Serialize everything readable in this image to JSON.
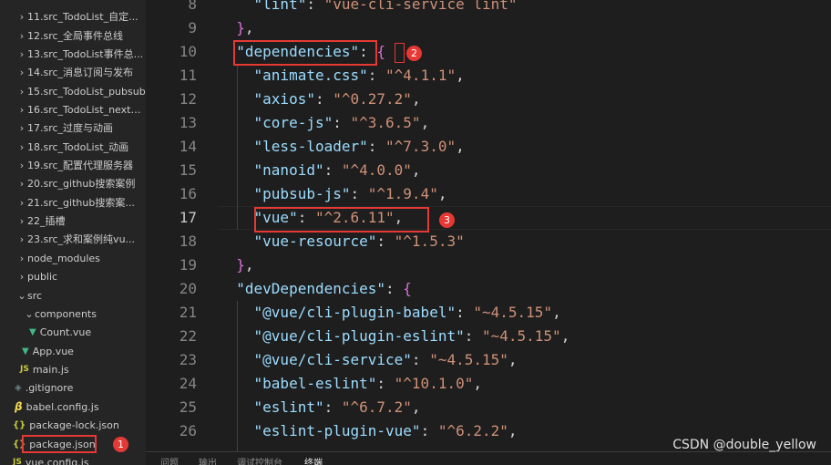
{
  "explorer": {
    "items": [
      {
        "label": "11.src_TodoList_自定...",
        "icon": "chevron-right",
        "kind": "folder"
      },
      {
        "label": "12.src_全局事件总线",
        "icon": "chevron-right",
        "kind": "folder"
      },
      {
        "label": "13.src_TodoList事件总...",
        "icon": "chevron-right",
        "kind": "folder"
      },
      {
        "label": "14.src_消息订阅与发布",
        "icon": "chevron-right",
        "kind": "folder"
      },
      {
        "label": "15.src_TodoList_pubsub",
        "icon": "chevron-right",
        "kind": "folder"
      },
      {
        "label": "16.src_TodoList_nextTi...",
        "icon": "chevron-right",
        "kind": "folder"
      },
      {
        "label": "17.src_过度与动画",
        "icon": "chevron-right",
        "kind": "folder"
      },
      {
        "label": "18.src_TodoList_动画",
        "icon": "chevron-right",
        "kind": "folder"
      },
      {
        "label": "19.src_配置代理服务器",
        "icon": "chevron-right",
        "kind": "folder"
      },
      {
        "label": "20.src_github搜索案例",
        "icon": "chevron-right",
        "kind": "folder"
      },
      {
        "label": "21.src_github搜索案...",
        "icon": "chevron-right",
        "kind": "folder"
      },
      {
        "label": "22_插槽",
        "icon": "chevron-right",
        "kind": "folder"
      },
      {
        "label": "23.src_求和案例纯vu...",
        "icon": "chevron-right",
        "kind": "folder"
      },
      {
        "label": "node_modules",
        "icon": "chevron-right",
        "kind": "folder"
      },
      {
        "label": "public",
        "icon": "chevron-right",
        "kind": "folder"
      },
      {
        "label": "src",
        "icon": "chevron-down",
        "kind": "folder"
      },
      {
        "label": "components",
        "icon": "chevron-down",
        "kind": "folder"
      },
      {
        "label": "Count.vue",
        "icon": "vue-file",
        "kind": "file"
      },
      {
        "label": "App.vue",
        "icon": "vue-file",
        "kind": "file"
      },
      {
        "label": "main.js",
        "icon": "js-file",
        "kind": "file"
      },
      {
        "label": ".gitignore",
        "icon": "git-file",
        "kind": "file"
      },
      {
        "label": "babel.config.js",
        "icon": "babel-file",
        "kind": "file"
      },
      {
        "label": "package-lock.json",
        "icon": "json-file",
        "kind": "file"
      },
      {
        "label": "package.json",
        "icon": "json-file",
        "kind": "file"
      },
      {
        "label": "vue.config.js",
        "icon": "js-file",
        "kind": "file"
      }
    ]
  },
  "icons": {
    "chevron_right": "›",
    "chevron_down": "⌄",
    "vue": "▼",
    "js": "JS",
    "git": "◈",
    "babel": "β",
    "json": "{}"
  },
  "editor": {
    "active_line": "17",
    "lines": [
      {
        "n": "8",
        "text": "    \"lint\": \"vue-cli-service lint\""
      },
      {
        "n": "9",
        "text": "  },"
      },
      {
        "n": "10",
        "text": "  \"dependencies\": {"
      },
      {
        "n": "11",
        "text": "    \"animate.css\": \"^4.1.1\","
      },
      {
        "n": "12",
        "text": "    \"axios\": \"^0.27.2\","
      },
      {
        "n": "13",
        "text": "    \"core-js\": \"^3.6.5\","
      },
      {
        "n": "14",
        "text": "    \"less-loader\": \"^7.3.0\","
      },
      {
        "n": "15",
        "text": "    \"nanoid\": \"^4.0.0\","
      },
      {
        "n": "16",
        "text": "    \"pubsub-js\": \"^1.9.4\","
      },
      {
        "n": "17",
        "text": "    \"vue\": \"^2.6.11\","
      },
      {
        "n": "18",
        "text": "    \"vue-resource\": \"^1.5.3\""
      },
      {
        "n": "19",
        "text": "  },"
      },
      {
        "n": "20",
        "text": "  \"devDependencies\": {"
      },
      {
        "n": "21",
        "text": "    \"@vue/cli-plugin-babel\": \"~4.5.15\","
      },
      {
        "n": "22",
        "text": "    \"@vue/cli-plugin-eslint\": \"~4.5.15\","
      },
      {
        "n": "23",
        "text": "    \"@vue/cli-service\": \"~4.5.15\","
      },
      {
        "n": "24",
        "text": "    \"babel-eslint\": \"^10.1.0\","
      },
      {
        "n": "25",
        "text": "    \"eslint\": \"^6.7.2\","
      },
      {
        "n": "26",
        "text": "    \"eslint-plugin-vue\": \"^6.2.2\","
      }
    ]
  },
  "annotations": {
    "badge1": "1",
    "badge2": "2",
    "badge3": "3",
    "color": "#e53935"
  },
  "panel": {
    "tabs": [
      "问题",
      "输出",
      "调试控制台",
      "终端"
    ],
    "active": "终端"
  },
  "watermark": "CSDN @double_yellow"
}
